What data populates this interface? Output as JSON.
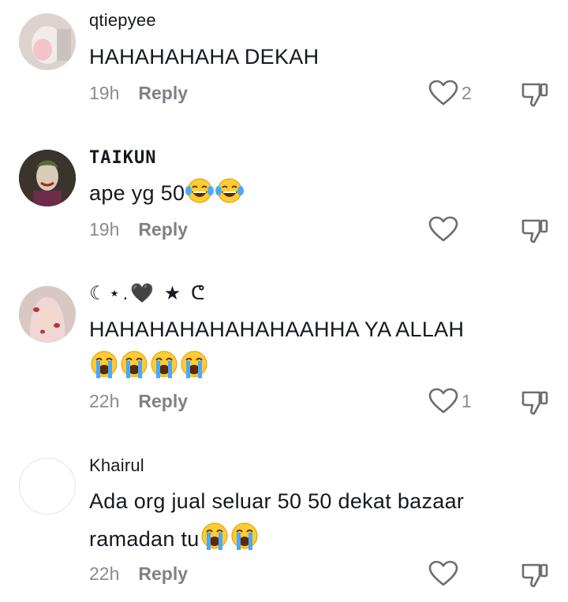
{
  "comments": [
    {
      "username": "qtiepyee",
      "text": "HAHAHAHAHA DEKAH",
      "time": "19h",
      "reply_label": "Reply",
      "like_count": "2",
      "avatar_icon": "photo-avatar"
    },
    {
      "username": "TAIKUN",
      "text": "ape yg 50",
      "emojis": [
        "tears-of-joy-emoji",
        "tears-of-joy-emoji"
      ],
      "time": "19h",
      "reply_label": "Reply",
      "like_count": "",
      "avatar_icon": "joker-avatar"
    },
    {
      "username": "☾⋆.🖤 ★ ᕦ",
      "text": "HAHAHAHAHAHAHAAHHA YA ALLAH",
      "emojis": [
        "loudly-crying-emoji",
        "loudly-crying-emoji",
        "loudly-crying-emoji",
        "loudly-crying-emoji"
      ],
      "time": "22h",
      "reply_label": "Reply",
      "like_count": "1",
      "avatar_icon": "hijab-avatar"
    },
    {
      "username": "Khairul",
      "text": "Ada org jual seluar 50 50 dekat bazaar ramadan tu",
      "emojis": [
        "loudly-crying-emoji",
        "loudly-crying-emoji"
      ],
      "time": "22h",
      "reply_label": "Reply",
      "like_count": "",
      "avatar_icon": "empty-avatar"
    }
  ],
  "colors": {
    "text_primary": "#161823",
    "text_secondary": "#8a8b91",
    "icon_stroke": "#6c6d73"
  }
}
